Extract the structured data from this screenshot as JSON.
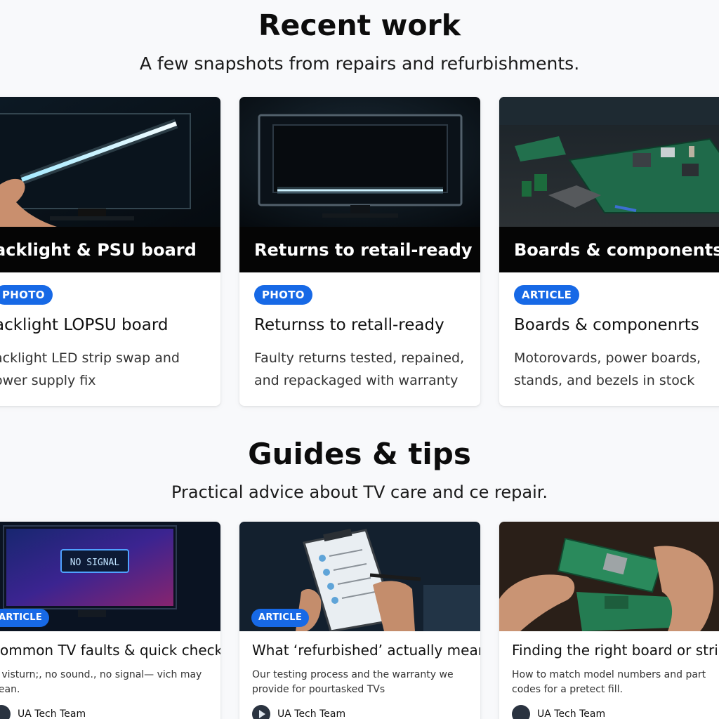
{
  "recent": {
    "title": "Recent work",
    "subtitle": "A few snapshots from repairs and refurbishments.",
    "cards": [
      {
        "caption": "acklight & PSU board",
        "badge": "PHOTO",
        "title": "acklight LOPSU board",
        "desc": "acklight LED strip swap and ower supply fix",
        "image_icon": "monitor-backlight-image"
      },
      {
        "caption": "Returns to retail-ready",
        "badge": "PHOTO",
        "title": "Returnss to retall-ready",
        "desc": "Faulty returns tested, repained, and repackaged with warranty",
        "image_icon": "monitor-image"
      },
      {
        "caption": "Boards & components",
        "badge": "ARTICLE",
        "title": "Boards & componenrts",
        "desc": "Motorovards, power boards, stands, and bezels in stock",
        "image_icon": "circuit-boards-image"
      }
    ]
  },
  "guides": {
    "title": "Guides & tips",
    "subtitle": "Practical advice about TV care and ce repair.",
    "cards": [
      {
        "badge": "ARTICLE",
        "title": "common TV faults & quick checks",
        "desc": "n visturn;, no sound., no signal— vich may nean.",
        "author": "UA Tech Team",
        "screen_text": "NO SIGNAL",
        "image_icon": "tv-no-signal-image"
      },
      {
        "badge": "ARTICLE",
        "title": "What ‘refurbished’ actually means",
        "desc": "Our testing process and the warranty we provide for pourtasked TVs",
        "author": "UA Tech Team",
        "image_icon": "clipboard-checklist-image"
      },
      {
        "title": "Finding the right board or strip",
        "desc": "How to match model numbers and part codes for a pretect fill.",
        "author": "UA Tech Team",
        "image_icon": "hands-circuit-board-image"
      }
    ]
  },
  "colors": {
    "badge": "#1769e6",
    "caption_bar": "#050505",
    "background": "#f8f9fb"
  }
}
